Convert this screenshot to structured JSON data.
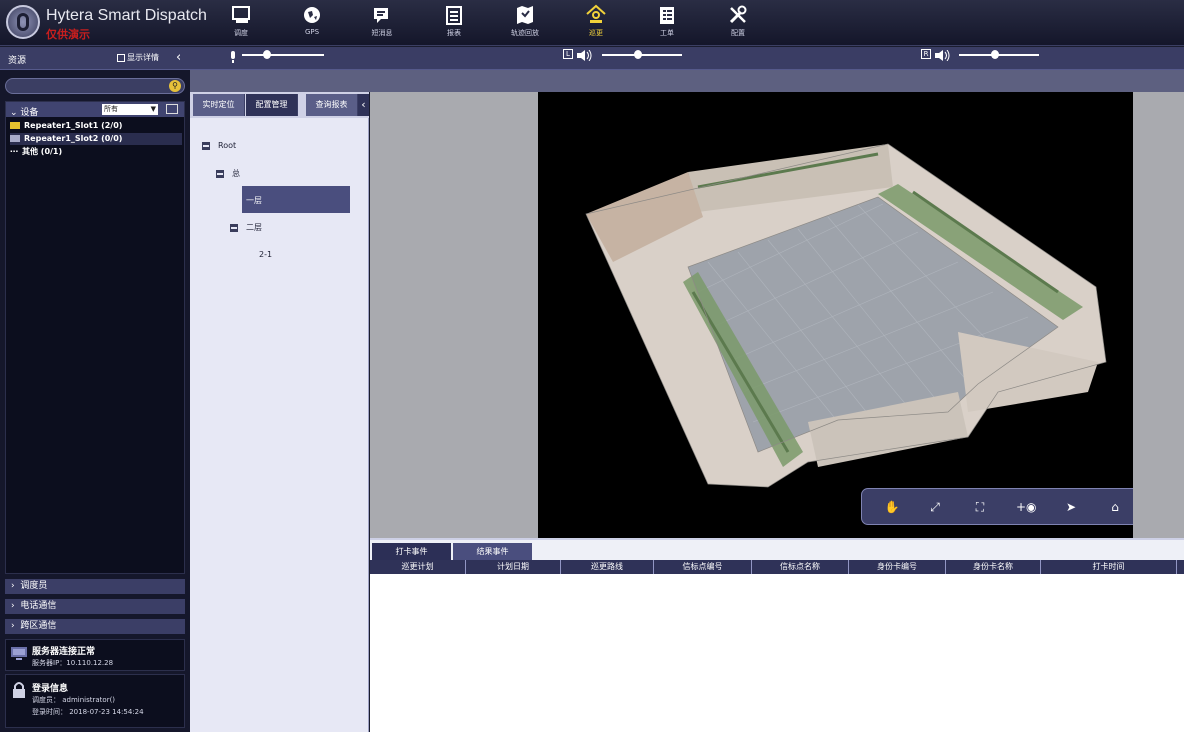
{
  "app": {
    "title": "Hytera Smart Dispatch",
    "subtitle": "仅供演示"
  },
  "nav": [
    {
      "label": "调度",
      "icon": "dispatch-icon"
    },
    {
      "label": "GPS",
      "icon": "globe-icon"
    },
    {
      "label": "短消息",
      "icon": "message-icon"
    },
    {
      "label": "报表",
      "icon": "report-icon"
    },
    {
      "label": "轨迹回放",
      "icon": "track-replay-icon"
    },
    {
      "label": "巡更",
      "icon": "patrol-icon"
    },
    {
      "label": "工单",
      "icon": "work-order-icon"
    },
    {
      "label": "配置",
      "icon": "settings-icon"
    }
  ],
  "nav_active": "巡更",
  "resource_bar": {
    "title": "资源",
    "show_detail": "显示详情"
  },
  "audio": {
    "mic_level": 0.3,
    "left_label": "L",
    "left_level": 0.45,
    "right_label": "R",
    "right_level": 0.45
  },
  "search": {
    "placeholder": ""
  },
  "devices": {
    "title": "设备",
    "filter": "所有",
    "items": [
      {
        "label": "Repeater1_Slot1 (2/0)",
        "selected": false
      },
      {
        "label": "Repeater1_Slot2 (0/0)",
        "selected": true
      },
      {
        "label": "其他 (0/1)",
        "selected": false
      }
    ]
  },
  "groups": [
    "调度员",
    "电话通信",
    "跨区通信"
  ],
  "server": {
    "title": "服务器连接正常",
    "ip": "服务器IP：10.110.12.28"
  },
  "login": {
    "title": "登录信息",
    "user": "调度员：  administrator()",
    "time": "登录时间：  2018-07-23 14:54:24"
  },
  "tree_tabs": [
    "实时定位",
    "配置管理",
    "查询报表"
  ],
  "tree_active_tab": "配置管理",
  "tree": {
    "root": "Root",
    "n1": "总",
    "n2": "一层",
    "n3": "二层",
    "n4": "2-1"
  },
  "map_tools": [
    "pan-hand-icon",
    "zoom-rect-icon",
    "fit-icon",
    "add-point-icon",
    "pointer-icon",
    "clear-icon"
  ],
  "events": {
    "tabs": [
      "打卡事件",
      "结果事件"
    ],
    "active_tab": "打卡事件",
    "columns": [
      "巡更计划",
      "计划日期",
      "巡更路线",
      "信标点编号",
      "信标点名称",
      "身份卡编号",
      "身份卡名称",
      "打卡时间"
    ]
  }
}
